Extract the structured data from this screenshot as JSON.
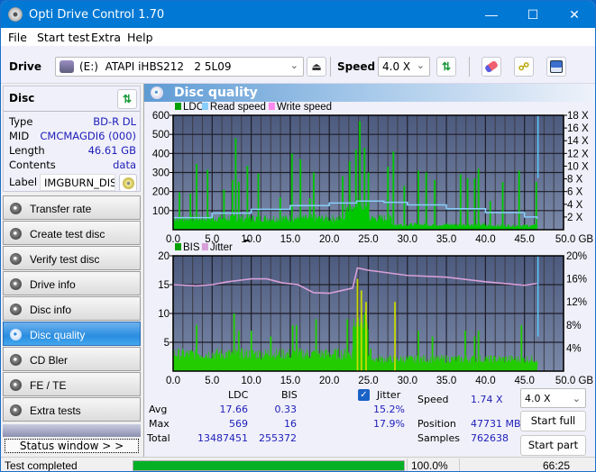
{
  "window": {
    "title": "Opti Drive Control 1.70",
    "controls": {
      "minimize": "—",
      "maximize": "☐",
      "close": "✕"
    }
  },
  "menu": [
    "File",
    "Start test",
    "Extra",
    "Help"
  ],
  "toolbar": {
    "drive_label": "Drive",
    "drive_value": "(E:)  ATAPI iHBS212   2 5L09",
    "speed_label": "Speed",
    "speed_value": "4.0 X",
    "icons": [
      "eject-icon",
      "refresh-icon",
      "eraser-icon",
      "burn-icon",
      "save-icon"
    ]
  },
  "disc": {
    "header": "Disc",
    "rows": [
      {
        "key": "Type",
        "value": "BD-R DL"
      },
      {
        "key": "MID",
        "value": "CMCMAGDI6 (000)"
      },
      {
        "key": "Length",
        "value": "46.61 GB"
      },
      {
        "key": "Contents",
        "value": "data"
      }
    ],
    "label_key": "Label",
    "label_value": "IMGBURN_DIS"
  },
  "nav": [
    {
      "label": "Transfer rate",
      "active": false
    },
    {
      "label": "Create test disc",
      "active": false
    },
    {
      "label": "Verify test disc",
      "active": false
    },
    {
      "label": "Drive info",
      "active": false
    },
    {
      "label": "Disc info",
      "active": false
    },
    {
      "label": "Disc quality",
      "active": true
    },
    {
      "label": "CD Bler",
      "active": false
    },
    {
      "label": "FE / TE",
      "active": false
    },
    {
      "label": "Extra tests",
      "active": false
    }
  ],
  "status_window_button": "Status window > >",
  "main": {
    "title": "Disc quality"
  },
  "chart_data": [
    {
      "type": "bar",
      "title": "LDC / Read speed",
      "legend": [
        {
          "name": "LDC",
          "color": "#00a000"
        },
        {
          "name": "Read speed",
          "color": "#87cefa"
        },
        {
          "name": "Write speed",
          "color": "#ff88ee"
        }
      ],
      "xlabel": "GB",
      "xlim": [
        0,
        50
      ],
      "x_ticks": [
        "0.0",
        "5.0",
        "10.0",
        "15.0",
        "20.0",
        "25.0",
        "30.0",
        "35.0",
        "40.0",
        "45.0",
        "50.0 GB"
      ],
      "ylim": [
        0,
        600
      ],
      "y_ticks": [
        "100",
        "200",
        "300",
        "400",
        "500",
        "600"
      ],
      "y2lim": [
        0,
        18
      ],
      "y2_ticks": [
        "2 X",
        "4 X",
        "6 X",
        "8 X",
        "10 X",
        "12 X",
        "14 X",
        "16 X",
        "18 X"
      ],
      "grid": true,
      "ldc_baseline_range": [
        40,
        80
      ],
      "ldc_spikes": [
        {
          "x": 0.8,
          "y": 195
        },
        {
          "x": 2.2,
          "y": 190
        },
        {
          "x": 3.0,
          "y": 345
        },
        {
          "x": 4.4,
          "y": 315
        },
        {
          "x": 6.5,
          "y": 210
        },
        {
          "x": 7.6,
          "y": 260
        },
        {
          "x": 8.0,
          "y": 480
        },
        {
          "x": 8.4,
          "y": 250
        },
        {
          "x": 9.5,
          "y": 335
        },
        {
          "x": 10.9,
          "y": 295
        },
        {
          "x": 13.7,
          "y": 170
        },
        {
          "x": 15.2,
          "y": 400
        },
        {
          "x": 16.3,
          "y": 370
        },
        {
          "x": 17.5,
          "y": 165
        },
        {
          "x": 18.0,
          "y": 300
        },
        {
          "x": 21.7,
          "y": 280
        },
        {
          "x": 22.6,
          "y": 360
        },
        {
          "x": 23.4,
          "y": 420
        },
        {
          "x": 23.9,
          "y": 569
        },
        {
          "x": 24.5,
          "y": 430
        },
        {
          "x": 25.0,
          "y": 300
        },
        {
          "x": 27.5,
          "y": 330
        },
        {
          "x": 28.2,
          "y": 410
        },
        {
          "x": 29.6,
          "y": 230
        },
        {
          "x": 31.4,
          "y": 310
        },
        {
          "x": 32.4,
          "y": 300
        },
        {
          "x": 33.5,
          "y": 260
        },
        {
          "x": 36.8,
          "y": 290
        },
        {
          "x": 37.7,
          "y": 270
        },
        {
          "x": 38.6,
          "y": 270
        },
        {
          "x": 39.1,
          "y": 320
        },
        {
          "x": 40.6,
          "y": 150
        },
        {
          "x": 42.2,
          "y": 250
        },
        {
          "x": 44.3,
          "y": 310
        },
        {
          "x": 46.5,
          "y": 250
        }
      ],
      "read_speed": [
        {
          "x": 0,
          "y": 1.9
        },
        {
          "x": 5,
          "y": 2.6
        },
        {
          "x": 10,
          "y": 3.2
        },
        {
          "x": 15,
          "y": 3.8
        },
        {
          "x": 20,
          "y": 4.2
        },
        {
          "x": 23.5,
          "y": 4.5
        },
        {
          "x": 27,
          "y": 4.3
        },
        {
          "x": 30,
          "y": 3.9
        },
        {
          "x": 35,
          "y": 3.3
        },
        {
          "x": 40,
          "y": 2.7
        },
        {
          "x": 45,
          "y": 2.0
        },
        {
          "x": 46.6,
          "y": 1.7
        }
      ],
      "end_marker_x": 46.61
    },
    {
      "type": "bar",
      "title": "BIS / Jitter",
      "legend": [
        {
          "name": "BIS",
          "color": "#00a000"
        },
        {
          "name": "Jitter",
          "color": "#d8a0d8"
        }
      ],
      "xlabel": "GB",
      "xlim": [
        0,
        50
      ],
      "x_ticks": [
        "0.0",
        "5.0",
        "10.0",
        "15.0",
        "20.0",
        "25.0",
        "30.0",
        "35.0",
        "40.0",
        "45.0",
        "50.0 GB"
      ],
      "ylim": [
        0,
        20
      ],
      "y_ticks": [
        "5",
        "10",
        "15",
        "20"
      ],
      "y2lim": [
        0,
        20
      ],
      "y2_ticks": [
        "4%",
        "8%",
        "12%",
        "16%",
        "20%"
      ],
      "grid": true,
      "bis_baseline_range": [
        2,
        4
      ],
      "bis_spikes": [
        {
          "x": 3.0,
          "y": 8
        },
        {
          "x": 7.8,
          "y": 10
        },
        {
          "x": 8.4,
          "y": 7
        },
        {
          "x": 10.0,
          "y": 7
        },
        {
          "x": 12.5,
          "y": 6
        },
        {
          "x": 15.3,
          "y": 8
        },
        {
          "x": 15.8,
          "y": 8
        },
        {
          "x": 18.3,
          "y": 9
        },
        {
          "x": 22.3,
          "y": 9
        },
        {
          "x": 23.6,
          "y": 16
        },
        {
          "x": 24.1,
          "y": 14
        },
        {
          "x": 24.7,
          "y": 12
        },
        {
          "x": 28.4,
          "y": 12
        },
        {
          "x": 31.4,
          "y": 7
        },
        {
          "x": 33.2,
          "y": 6
        },
        {
          "x": 37.4,
          "y": 7
        },
        {
          "x": 38.6,
          "y": 6
        },
        {
          "x": 39.1,
          "y": 7
        },
        {
          "x": 44.6,
          "y": 8
        }
      ],
      "jitter": [
        {
          "x": 0,
          "y": 15.0
        },
        {
          "x": 3,
          "y": 14.8
        },
        {
          "x": 5,
          "y": 15.0
        },
        {
          "x": 7,
          "y": 15.5
        },
        {
          "x": 10,
          "y": 16.0
        },
        {
          "x": 12,
          "y": 16.0
        },
        {
          "x": 14,
          "y": 15.3
        },
        {
          "x": 16,
          "y": 15.0
        },
        {
          "x": 18,
          "y": 13.6
        },
        {
          "x": 20,
          "y": 13.5
        },
        {
          "x": 23,
          "y": 14.4
        },
        {
          "x": 23.6,
          "y": 17.9
        },
        {
          "x": 25,
          "y": 17.5
        },
        {
          "x": 30,
          "y": 16.6
        },
        {
          "x": 35,
          "y": 16.3
        },
        {
          "x": 40,
          "y": 15.5
        },
        {
          "x": 45,
          "y": 14.9
        },
        {
          "x": 46.6,
          "y": 15.2
        }
      ],
      "end_marker_x": 46.61
    }
  ],
  "stats": {
    "headers": {
      "ldc": "LDC",
      "bis": "BIS",
      "jitter": "Jitter"
    },
    "jitter_checked": true,
    "rows": [
      {
        "label": "Avg",
        "ldc": "17.66",
        "bis": "0.33",
        "jitter": "15.2%"
      },
      {
        "label": "Max",
        "ldc": "569",
        "bis": "16",
        "jitter": "17.9%"
      },
      {
        "label": "Total",
        "ldc": "13487451",
        "bis": "255372",
        "jitter": ""
      }
    ],
    "speed_label": "Speed",
    "speed_value": "1.74 X",
    "position_label": "Position",
    "position_value": "47731 MB",
    "samples_label": "Samples",
    "samples_value": "762638",
    "speed_select": "4.0 X",
    "start_full": "Start full",
    "start_part": "Start part"
  },
  "statusbar": {
    "status": "Test completed",
    "progress": 1.0,
    "progress_text": "100.0%",
    "elapsed": "66:25"
  }
}
